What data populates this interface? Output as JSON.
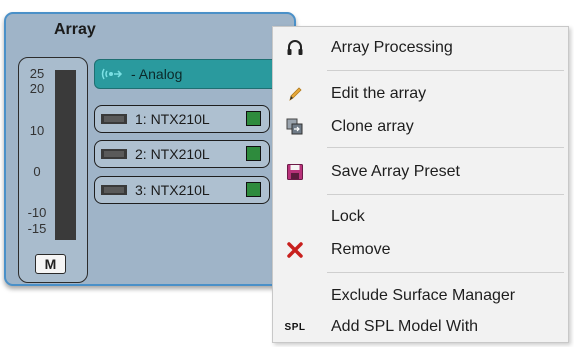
{
  "panel": {
    "title": "Array",
    "meter": {
      "ticks": [
        "25",
        "20",
        "10",
        "0",
        "-10",
        "-15"
      ],
      "mute_label": "M"
    },
    "input": {
      "label": "- Analog",
      "icon": "analog-input-icon"
    },
    "speakers": [
      {
        "label": "1: NTX210L",
        "status_color": "#2e8b3d"
      },
      {
        "label": "2: NTX210L",
        "status_color": "#2e8b3d"
      },
      {
        "label": "3: NTX210L",
        "status_color": "#2e8b3d"
      }
    ],
    "colors": {
      "panel_bg": "#9fb4c8",
      "panel_border": "#4a90c8",
      "input_bg": "#2a9a9e"
    }
  },
  "menu": {
    "items": [
      {
        "label": "Array Processing",
        "icon": "headphones-icon"
      },
      {
        "label": "Edit the array",
        "icon": "pencil-icon"
      },
      {
        "label": "Clone array",
        "icon": "clone-icon"
      },
      {
        "label": "Save Array Preset",
        "icon": "save-icon"
      },
      {
        "label": "Lock",
        "icon": ""
      },
      {
        "label": "Remove",
        "icon": "remove-icon"
      },
      {
        "label": "Exclude Surface Manager",
        "icon": ""
      },
      {
        "label": "Add SPL Model With",
        "icon": "spl-icon",
        "icon_text": "SPL"
      }
    ]
  }
}
